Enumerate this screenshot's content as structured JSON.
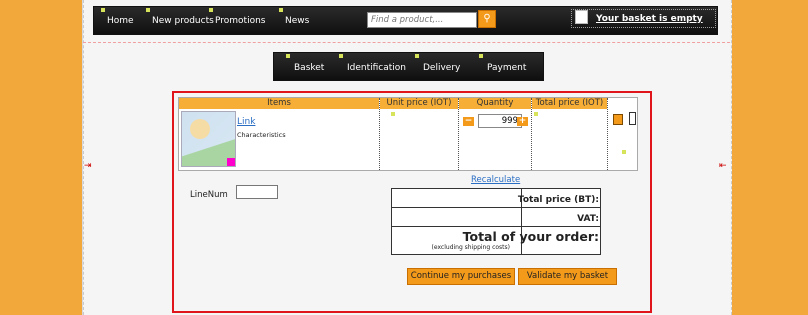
{
  "nav": {
    "items": [
      "Home",
      "New products",
      "Promotions",
      "News"
    ],
    "search_placeholder": "Find a product,...",
    "cart_label": "Your basket is empty"
  },
  "steps": [
    "Basket",
    "Identification",
    "Delivery",
    "Payment"
  ],
  "basket_table": {
    "columns": [
      "Items",
      "Unit price (IOT)",
      "Quantity",
      "Total price (IOT)"
    ],
    "item_link": "Link",
    "item_desc": "Characteristics",
    "quantity": "999"
  },
  "recalculate_label": "Recalculate",
  "linenum_label": "LineNum",
  "totals": {
    "total_bt_label": "Total price (BT):",
    "vat_label": "VAT:",
    "order_label": "Total of your order:",
    "order_note": "(excluding shipping costs)"
  },
  "buttons": {
    "continue": "Continue my purchases",
    "validate": "Validate my basket"
  },
  "icons": {
    "search": "search-icon",
    "bag": "shopping-bag-icon",
    "minus": "minus-icon",
    "plus": "plus-icon",
    "delete": "delete-icon"
  },
  "colors": {
    "accent": "#f49a1a",
    "header_bg": "#f7ae36",
    "highlight_border": "#e0141b",
    "link": "#2a6ec4"
  }
}
